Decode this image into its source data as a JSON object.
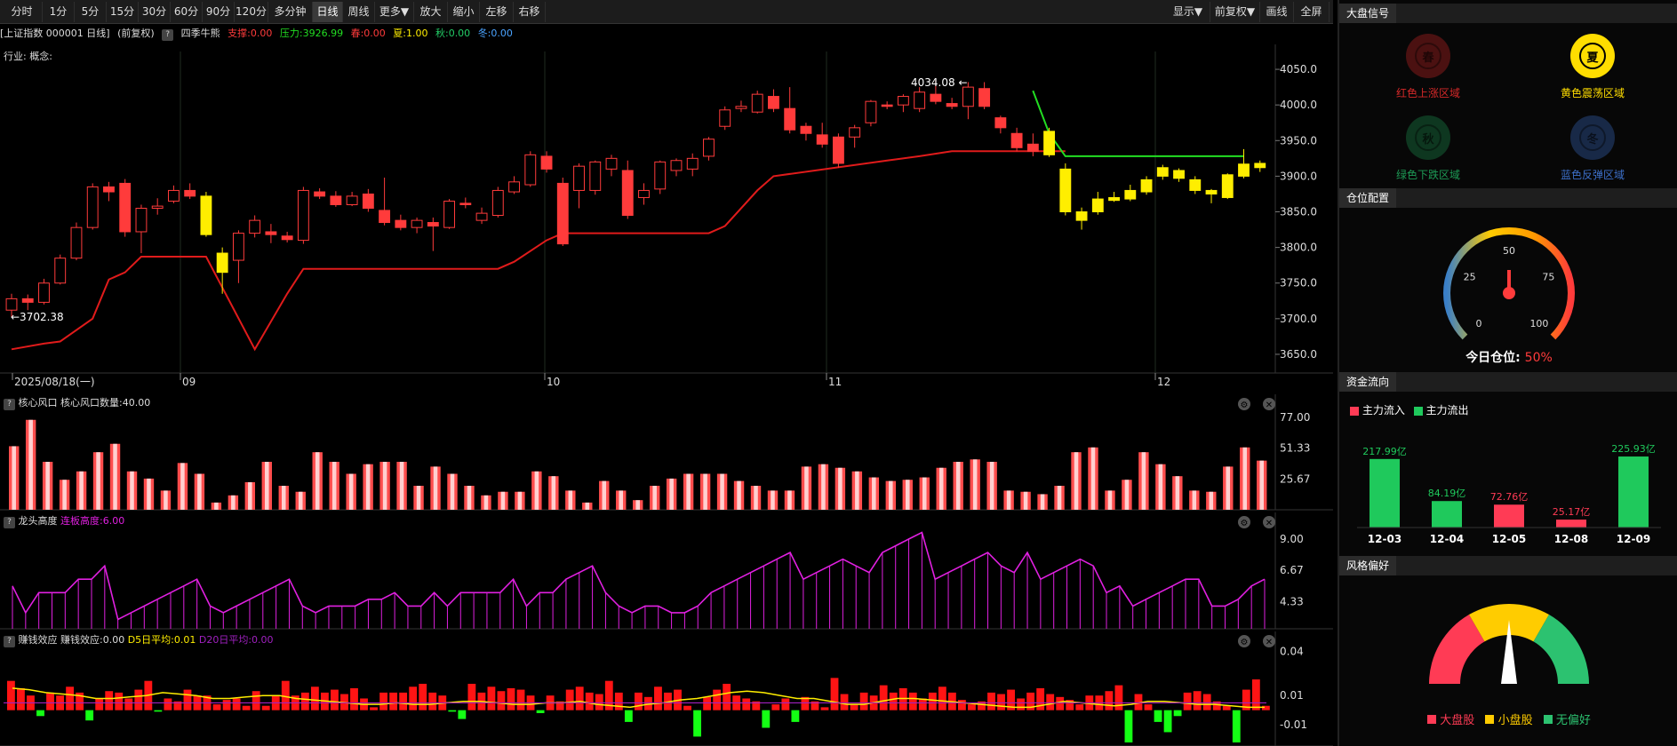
{
  "toolbar": {
    "periods": [
      "分时",
      "1分",
      "5分",
      "15分",
      "30分",
      "60分",
      "90分",
      "120分",
      "多分钟",
      "日线",
      "周线",
      "更多▼",
      "放大",
      "缩小",
      "左移",
      "右移"
    ],
    "active_period": "日线",
    "right": [
      "显示▼",
      "前复权▼",
      "画线",
      "全屏"
    ]
  },
  "info": {
    "title": "[上证指数 000001 日线]",
    "adj": "(前复权)",
    "indicator": "四季牛熊",
    "support": "支撑:0.00",
    "pressure": "压力:3926.99",
    "spring": "春:0.00",
    "summer": "夏:1.00",
    "autumn": "秋:0.00",
    "winter": "冬:0.00"
  },
  "industry": "行业: 概念:",
  "colors": {
    "up": "#ff3b3b",
    "down": "#ff3b3b",
    "summer": "#ffee00",
    "support": "#e01b1b",
    "pressure": "#22dd22",
    "grid": "#1e2a1e",
    "magenta": "#e020e0"
  },
  "chart_data": [
    {
      "type": "candlestick",
      "title": "上证指数 000001 日线",
      "y_ticks": [
        "4050.0",
        "4000.0",
        "3950.0",
        "3900.0",
        "3850.0",
        "3800.0",
        "3750.0",
        "3700.0",
        "3650.0"
      ],
      "ylim": [
        3630,
        4075
      ],
      "x_labels": [
        "2025/08/18(一)",
        "09",
        "10",
        "11",
        "12"
      ],
      "high_label": "4034.08",
      "low_label": "3702.38",
      "candles": [
        [
          3712,
          3728,
          3702,
          3735,
          "r"
        ],
        [
          3728,
          3723,
          3712,
          3734,
          "r"
        ],
        [
          3723,
          3750,
          3720,
          3756,
          "r"
        ],
        [
          3750,
          3785,
          3748,
          3790,
          "r"
        ],
        [
          3785,
          3828,
          3782,
          3835,
          "r"
        ],
        [
          3828,
          3885,
          3825,
          3890,
          "r"
        ],
        [
          3885,
          3878,
          3865,
          3892,
          "r"
        ],
        [
          3890,
          3822,
          3815,
          3896,
          "r"
        ],
        [
          3822,
          3855,
          3792,
          3860,
          "r"
        ],
        [
          3855,
          3858,
          3846,
          3869,
          "r"
        ],
        [
          3865,
          3880,
          3862,
          3887,
          "r"
        ],
        [
          3880,
          3872,
          3868,
          3890,
          "r"
        ],
        [
          3872,
          3818,
          3815,
          3878,
          "y"
        ],
        [
          3792,
          3765,
          3735,
          3800,
          "y"
        ],
        [
          3782,
          3820,
          3750,
          3824,
          "r"
        ],
        [
          3820,
          3838,
          3814,
          3845,
          "r"
        ],
        [
          3822,
          3818,
          3806,
          3833,
          "r"
        ],
        [
          3816,
          3811,
          3807,
          3822,
          "r"
        ],
        [
          3810,
          3880,
          3805,
          3885,
          "r"
        ],
        [
          3878,
          3872,
          3868,
          3883,
          "r"
        ],
        [
          3872,
          3860,
          3857,
          3879,
          "r"
        ],
        [
          3860,
          3872,
          3858,
          3878,
          "r"
        ],
        [
          3875,
          3855,
          3850,
          3882,
          "r"
        ],
        [
          3852,
          3835,
          3831,
          3898,
          "r"
        ],
        [
          3838,
          3828,
          3824,
          3846,
          "r"
        ],
        [
          3828,
          3838,
          3820,
          3842,
          "r"
        ],
        [
          3835,
          3830,
          3795,
          3842,
          "r"
        ],
        [
          3828,
          3865,
          3826,
          3868,
          "r"
        ],
        [
          3862,
          3860,
          3855,
          3870,
          "r"
        ],
        [
          3838,
          3848,
          3833,
          3856,
          "r"
        ],
        [
          3845,
          3880,
          3842,
          3885,
          "r"
        ],
        [
          3878,
          3892,
          3875,
          3900,
          "r"
        ],
        [
          3888,
          3930,
          3885,
          3935,
          "r"
        ],
        [
          3928,
          3910,
          3905,
          3935,
          "r"
        ],
        [
          3890,
          3805,
          3802,
          3898,
          "r"
        ],
        [
          3880,
          3914,
          3855,
          3918,
          "r"
        ],
        [
          3880,
          3920,
          3874,
          3922,
          "r"
        ],
        [
          3910,
          3925,
          3900,
          3930,
          "r"
        ],
        [
          3908,
          3845,
          3840,
          3922,
          "r"
        ],
        [
          3870,
          3880,
          3860,
          3890,
          "r"
        ],
        [
          3882,
          3920,
          3875,
          3922,
          "r"
        ],
        [
          3908,
          3922,
          3900,
          3925,
          "r"
        ],
        [
          3910,
          3925,
          3900,
          3932,
          "r"
        ],
        [
          3928,
          3952,
          3922,
          3955,
          "r"
        ],
        [
          3970,
          3993,
          3965,
          3998,
          "r"
        ],
        [
          3995,
          3998,
          3990,
          4006,
          "r"
        ],
        [
          3990,
          4015,
          3988,
          4020,
          "r"
        ],
        [
          4012,
          3995,
          3990,
          4022,
          "r"
        ],
        [
          3995,
          3965,
          3960,
          4025,
          "r"
        ],
        [
          3970,
          3960,
          3950,
          3975,
          "r"
        ],
        [
          3958,
          3945,
          3940,
          3975,
          "r"
        ],
        [
          3955,
          3918,
          3912,
          3960,
          "r"
        ],
        [
          3955,
          3968,
          3940,
          3972,
          "r"
        ],
        [
          3975,
          4005,
          3970,
          4007,
          "r"
        ],
        [
          4000,
          3998,
          3994,
          4005,
          "r"
        ],
        [
          4000,
          4012,
          3990,
          4015,
          "r"
        ],
        [
          3995,
          4018,
          3990,
          4025,
          "r"
        ],
        [
          4015,
          4005,
          4001,
          4035,
          "r"
        ],
        [
          4002,
          3998,
          3994,
          4010,
          "r"
        ],
        [
          3998,
          4025,
          3980,
          4032,
          "r"
        ],
        [
          4023,
          3998,
          3994,
          4032,
          "r"
        ],
        [
          3982,
          3968,
          3960,
          3985,
          "r"
        ],
        [
          3960,
          3940,
          3935,
          3968,
          "r"
        ],
        [
          3945,
          3935,
          3928,
          3960,
          "r"
        ],
        [
          3930,
          3963,
          3927,
          3968,
          "y"
        ],
        [
          3910,
          3850,
          3845,
          3918,
          "y"
        ],
        [
          3850,
          3838,
          3825,
          3856,
          "y"
        ],
        [
          3850,
          3868,
          3846,
          3878,
          "y"
        ],
        [
          3866,
          3870,
          3864,
          3878,
          "y"
        ],
        [
          3868,
          3880,
          3865,
          3888,
          "y"
        ],
        [
          3878,
          3895,
          3874,
          3900,
          "y"
        ],
        [
          3900,
          3912,
          3895,
          3916,
          "y"
        ],
        [
          3908,
          3897,
          3892,
          3911,
          "y"
        ],
        [
          3895,
          3880,
          3875,
          3900,
          "y"
        ],
        [
          3880,
          3875,
          3862,
          3882,
          "y"
        ],
        [
          3870,
          3902,
          3868,
          3904,
          "y"
        ],
        [
          3900,
          3917,
          3897,
          3938,
          "y"
        ],
        [
          3918,
          3912,
          3906,
          3922,
          "y"
        ]
      ],
      "support_line": [
        [
          0,
          3657
        ],
        [
          2,
          3665
        ],
        [
          3,
          3668
        ],
        [
          5,
          3700
        ],
        [
          6,
          3755
        ],
        [
          7,
          3765
        ],
        [
          8,
          3787
        ],
        [
          12,
          3787
        ],
        [
          15,
          3657
        ],
        [
          17,
          3735
        ],
        [
          18,
          3770
        ],
        [
          30,
          3770
        ],
        [
          31,
          3780
        ],
        [
          33,
          3810
        ],
        [
          34,
          3820
        ],
        [
          43,
          3820
        ],
        [
          44,
          3830
        ],
        [
          46,
          3880
        ],
        [
          47,
          3900
        ],
        [
          54,
          3922
        ],
        [
          56,
          3928
        ],
        [
          58,
          3935
        ],
        [
          65,
          3935
        ]
      ],
      "pressure_line": [
        [
          63,
          4020
        ],
        [
          64,
          3960
        ],
        [
          65,
          3928
        ],
        [
          76,
          3928
        ]
      ]
    },
    {
      "type": "bar",
      "title": "核心风口",
      "label": "核心风口数量:40.00",
      "y_ticks": [
        "77.00",
        "51.33",
        "25.67"
      ],
      "ylim": [
        0,
        80
      ],
      "values": [
        53,
        75,
        40,
        25,
        32,
        48,
        55,
        32,
        26,
        16,
        39,
        30,
        6,
        12,
        23,
        40,
        20,
        15,
        48,
        40,
        30,
        38,
        40,
        40,
        20,
        36,
        30,
        20,
        12,
        15,
        15,
        32,
        28,
        16,
        6,
        24,
        16,
        8,
        20,
        26,
        30,
        30,
        30,
        24,
        20,
        16,
        16,
        36,
        38,
        35,
        32,
        27,
        24,
        25,
        27,
        35,
        40,
        42,
        40,
        16,
        15,
        13,
        20,
        48,
        52,
        16,
        25,
        48,
        38,
        28,
        16,
        15,
        36,
        52,
        41
      ],
      "color": "#ff5555"
    },
    {
      "type": "line",
      "title": "龙头高度",
      "label": "连板高度:6.00",
      "y_ticks": [
        "9.00",
        "6.67",
        "4.33"
      ],
      "ylim": [
        2.3,
        9.6
      ],
      "values": [
        5.5,
        3.5,
        5,
        5,
        5,
        6,
        6,
        7,
        3,
        3.5,
        4,
        4.5,
        5,
        5.5,
        6,
        4,
        3.5,
        4,
        4.5,
        5,
        5.5,
        6,
        4,
        3.5,
        4,
        4,
        4,
        4.5,
        4.5,
        5,
        4,
        4,
        5,
        4,
        5,
        5,
        5,
        5,
        6,
        4,
        5,
        5,
        6,
        6.5,
        7,
        5,
        4,
        3.5,
        4,
        4,
        3.5,
        3.5,
        4,
        5,
        5.5,
        6,
        6.5,
        7,
        7.5,
        8,
        6,
        6.5,
        7,
        7.5,
        7,
        6.5,
        8,
        8.5,
        9,
        9.5,
        6,
        6.5,
        7,
        7.5,
        8,
        7,
        6.5,
        8,
        6,
        6.5,
        7,
        7.5,
        7,
        5,
        5.5,
        4,
        4.5,
        5,
        5.5,
        6,
        6,
        4,
        4,
        4.5,
        5.5,
        6
      ],
      "color": "#e020e0"
    },
    {
      "type": "bar",
      "title": "赚钱效应",
      "label": "赚钱效应:0.00",
      "series_labels": [
        "D5日平均:0.01",
        "D20日平均:0.00"
      ],
      "y_ticks": [
        "0.04",
        "0.01",
        "-0.01"
      ],
      "ylim": [
        -0.022,
        0.041
      ],
      "values": [
        0.02,
        0.015,
        0.01,
        -0.004,
        0.012,
        0.01,
        0.016,
        0.012,
        -0.007,
        0.008,
        0.013,
        0.012,
        0.008,
        0.014,
        0.02,
        -0.001,
        0.008,
        0.006,
        0.014,
        0.01,
        0.01,
        0.004,
        0.007,
        0.008,
        0.003,
        0.013,
        0.003,
        0.01,
        0.02,
        0.01,
        0.012,
        0.016,
        0.012,
        0.014,
        0.011,
        0.015,
        0.008,
        0.002,
        0.012,
        0.012,
        0.012,
        0.016,
        0.018,
        0.012,
        0.01,
        -0.001,
        -0.006,
        0.018,
        0.012,
        0.016,
        0.013,
        0.015,
        0.014,
        0.01,
        -0.002,
        0.01,
        0.006,
        0.014,
        0.016,
        0.012,
        0.011,
        0.02,
        0.012,
        -0.008,
        0.012,
        0.009,
        0.016,
        0.012,
        0.014,
        0.003,
        -0.018,
        0.009,
        0.014,
        0.018,
        0.01,
        0.008,
        0.006,
        -0.012,
        0.004,
        0.008,
        -0.008,
        0.009,
        0.006,
        0.002,
        0.022,
        0.011,
        0.004,
        0.012,
        0.01,
        0.017,
        0.012,
        0.015,
        0.012,
        0.008,
        0.012,
        0.016,
        0.012,
        0.007,
        0.004,
        0.006,
        0.012,
        0.011,
        0.014,
        0.008,
        0.012,
        0.015,
        0.011,
        0.009,
        0.007,
        0.004,
        0.01,
        0.01,
        0.013,
        0.017,
        -0.022,
        0.011,
        0.004,
        -0.008,
        -0.015,
        -0.004,
        0.012,
        0.013,
        0.011,
        0.006,
        0.003,
        -0.022,
        0.014,
        0.021,
        0.003
      ],
      "d5": [
        0.015,
        0.014,
        0.012,
        0.011,
        0.01,
        0.008,
        0.008,
        0.009,
        0.01,
        0.012,
        0.011,
        0.01,
        0.008,
        0.008,
        0.009,
        0.01,
        0.01,
        0.008,
        0.007,
        0.006,
        0.005,
        0.004,
        0.004,
        0.005,
        0.004,
        0.004,
        0.005,
        0.006,
        0.006,
        0.005,
        0.004,
        0.004,
        0.005,
        0.005,
        0.006,
        0.004,
        0.003,
        0.002,
        0.004,
        0.005,
        0.007,
        0.008,
        0.01,
        0.012,
        0.013,
        0.012,
        0.01,
        0.008,
        0.008,
        0.006,
        0.004,
        0.004,
        0.006,
        0.008,
        0.008,
        0.007,
        0.006,
        0.005,
        0.004,
        0.003,
        0.002,
        0.002,
        0.004,
        0.006,
        0.005,
        0.004,
        0.003,
        0.004,
        0.006,
        0.006,
        0.005,
        0.004,
        0.004,
        0.003,
        0.002,
        0.002
      ],
      "d20": 0.005
    }
  ],
  "side": {
    "signal_title": "大盘信号",
    "seasons": [
      {
        "char": "春",
        "label": "红色上涨区域",
        "color": "#d42828"
      },
      {
        "char": "夏",
        "label": "黄色震荡区域",
        "color": "#ffdd00"
      },
      {
        "char": "秋",
        "label": "绿色下跌区域",
        "color": "#1d9a55"
      },
      {
        "char": "冬",
        "label": "蓝色反弹区域",
        "color": "#3c6fc8"
      }
    ],
    "position_title": "仓位配置",
    "gauge_ticks": [
      "0",
      "25",
      "50",
      "75",
      "100"
    ],
    "gauge_value": 50,
    "position_label": "今日仓位:",
    "position_value": "50%",
    "flow_title": "资金流向",
    "flow_legend": [
      "主力流入",
      "主力流出"
    ],
    "flow": [
      {
        "date": "12-03",
        "value": "217.99亿",
        "dir": "out",
        "amount": 217.99
      },
      {
        "date": "12-04",
        "value": "84.19亿",
        "dir": "out",
        "amount": 84.19
      },
      {
        "date": "12-05",
        "value": "72.76亿",
        "dir": "in",
        "amount": 72.76
      },
      {
        "date": "12-08",
        "value": "25.17亿",
        "dir": "in",
        "amount": 25.17
      },
      {
        "date": "12-09",
        "value": "225.93亿",
        "dir": "out",
        "amount": 225.93
      }
    ],
    "style_title": "风格偏好",
    "style_legend": [
      "大盘股",
      "小盘股",
      "无偏好"
    ],
    "style_colors": [
      "#ff3b55",
      "#ffcc00",
      "#2cc270"
    ]
  }
}
